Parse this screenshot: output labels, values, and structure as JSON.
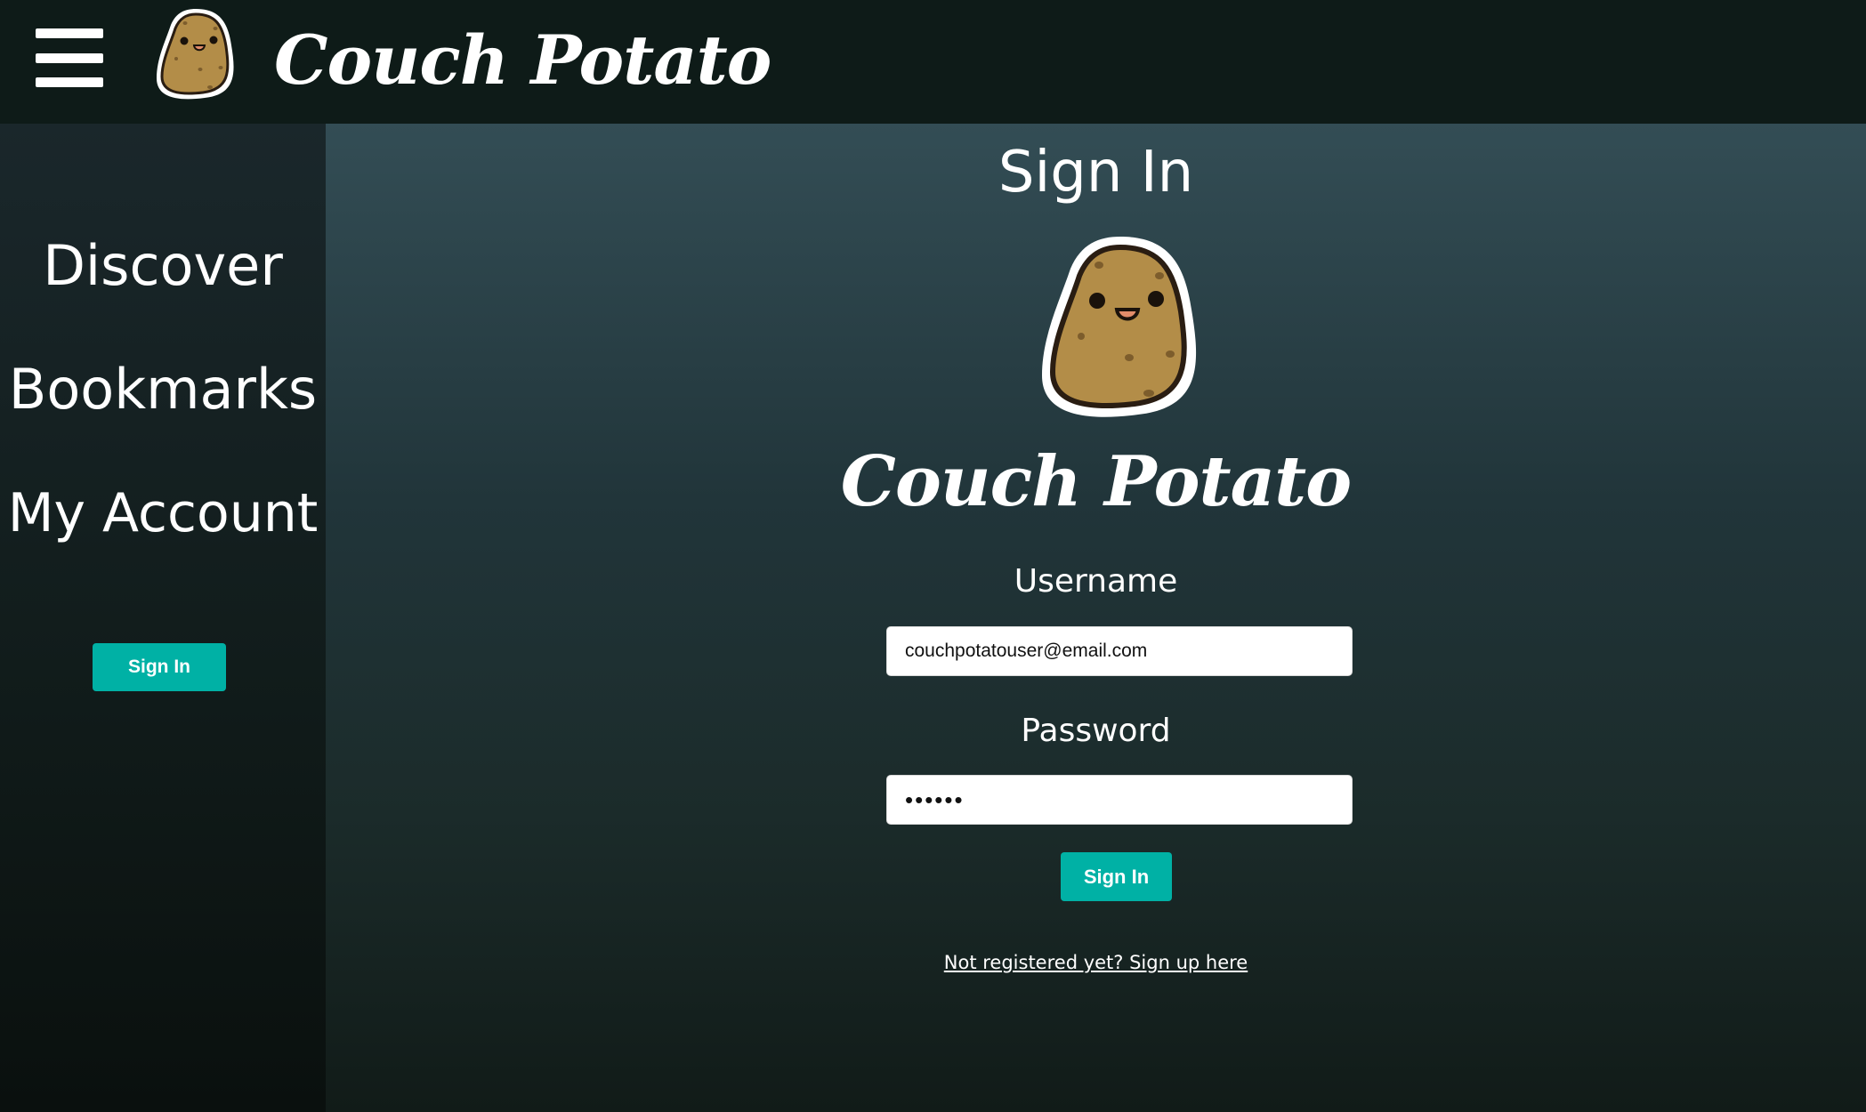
{
  "header": {
    "menu_icon": "hamburger-menu-icon",
    "logo_icon": "potato-mascot-icon",
    "brand": "Couch Potato"
  },
  "sidebar": {
    "items": [
      {
        "label": "Discover"
      },
      {
        "label": "Bookmarks"
      },
      {
        "label": "My Account"
      }
    ],
    "sign_in_label": "Sign In"
  },
  "main": {
    "title": "Sign In",
    "logo_icon": "potato-mascot-icon",
    "brand": "Couch Potato",
    "username_label": "Username",
    "username_value": "couchpotatouser@email.com",
    "password_label": "Password",
    "password_value": "••••••",
    "sign_in_label": "Sign In",
    "signup_link": "Not registered yet? Sign up here"
  },
  "colors": {
    "accent": "#00b1a5",
    "header_bg": "#0e1b18",
    "potato": "#b38d48"
  }
}
